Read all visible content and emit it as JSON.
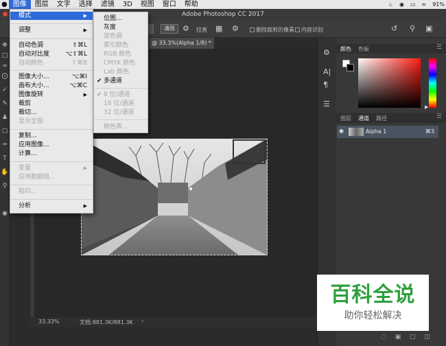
{
  "menubar": {
    "items": [
      "图像",
      "图层",
      "文字",
      "选择",
      "滤镜",
      "3D",
      "视图",
      "窗口",
      "帮助"
    ],
    "battery": "91%"
  },
  "window_title": "Adobe Photoshop CC 2017",
  "options": {
    "clear_label": "清除",
    "straighten_label": "拉直",
    "delete_cropped_label": "删除裁剪的像素",
    "content_aware_label": "内容识别"
  },
  "document": {
    "tab_title": "@ 33.3%(Alpha 1/8) *",
    "zoom": "33.33%",
    "doc_info": "文档:881.3K/881.3K"
  },
  "image_menu": {
    "items": [
      {
        "label": "模式",
        "shortcut": "",
        "submenu": true,
        "disabled": false,
        "highlighted": true
      },
      {
        "label": "调整",
        "shortcut": "",
        "submenu": true,
        "disabled": false
      },
      {
        "label": "自动色调",
        "shortcut": "⇧⌘L",
        "disabled": false
      },
      {
        "label": "自动对比度",
        "shortcut": "⌥⇧⌘L",
        "disabled": false
      },
      {
        "label": "自动颜色",
        "shortcut": "⇧⌘B",
        "disabled": true
      },
      {
        "label": "图像大小...",
        "shortcut": "⌥⌘I",
        "disabled": false
      },
      {
        "label": "画布大小...",
        "shortcut": "⌥⌘C",
        "disabled": false
      },
      {
        "label": "图像旋转",
        "shortcut": "",
        "submenu": true,
        "disabled": false
      },
      {
        "label": "裁剪",
        "shortcut": "",
        "disabled": false
      },
      {
        "label": "裁切...",
        "shortcut": "",
        "disabled": false
      },
      {
        "label": "显示全部",
        "shortcut": "",
        "disabled": true
      },
      {
        "label": "复制...",
        "shortcut": "",
        "disabled": false
      },
      {
        "label": "应用图像...",
        "shortcut": "",
        "disabled": false
      },
      {
        "label": "计算...",
        "shortcut": "",
        "disabled": false
      },
      {
        "label": "变量",
        "shortcut": "",
        "submenu": true,
        "disabled": true
      },
      {
        "label": "应用数据组...",
        "shortcut": "",
        "disabled": true
      },
      {
        "label": "陷印...",
        "shortcut": "",
        "disabled": true
      },
      {
        "label": "分析",
        "shortcut": "",
        "submenu": true,
        "disabled": false
      }
    ]
  },
  "mode_submenu": {
    "items": [
      {
        "label": "位图...",
        "disabled": false,
        "checked": false
      },
      {
        "label": "灰度",
        "disabled": false,
        "checked": false
      },
      {
        "label": "双色调",
        "disabled": true,
        "checked": false
      },
      {
        "label": "索引颜色",
        "disabled": true,
        "checked": false
      },
      {
        "label": "RGB 颜色",
        "disabled": true,
        "checked": false
      },
      {
        "label": "CMYK 颜色",
        "disabled": true,
        "checked": false
      },
      {
        "label": "Lab 颜色",
        "disabled": true,
        "checked": false
      },
      {
        "label": "多通道",
        "disabled": false,
        "checked": true
      },
      {
        "label": "8 位/通道",
        "disabled": true,
        "checked": true
      },
      {
        "label": "16 位/通道",
        "disabled": true,
        "checked": false
      },
      {
        "label": "32 位/通道",
        "disabled": true,
        "checked": false
      },
      {
        "label": "颜色表...",
        "disabled": true,
        "checked": false
      }
    ]
  },
  "panels": {
    "color_tabs": [
      "颜色",
      "色板"
    ],
    "channel_tabs": [
      "图层",
      "通道",
      "路径"
    ],
    "channel": {
      "name": "Alpha 1",
      "shortcut": "⌘3"
    }
  },
  "watermark": {
    "title": "百科全说",
    "subtitle": "助你轻松解决"
  },
  "colors": {
    "menu_highlight": "#2f6bd8",
    "watermark_green": "#2ea13c"
  }
}
